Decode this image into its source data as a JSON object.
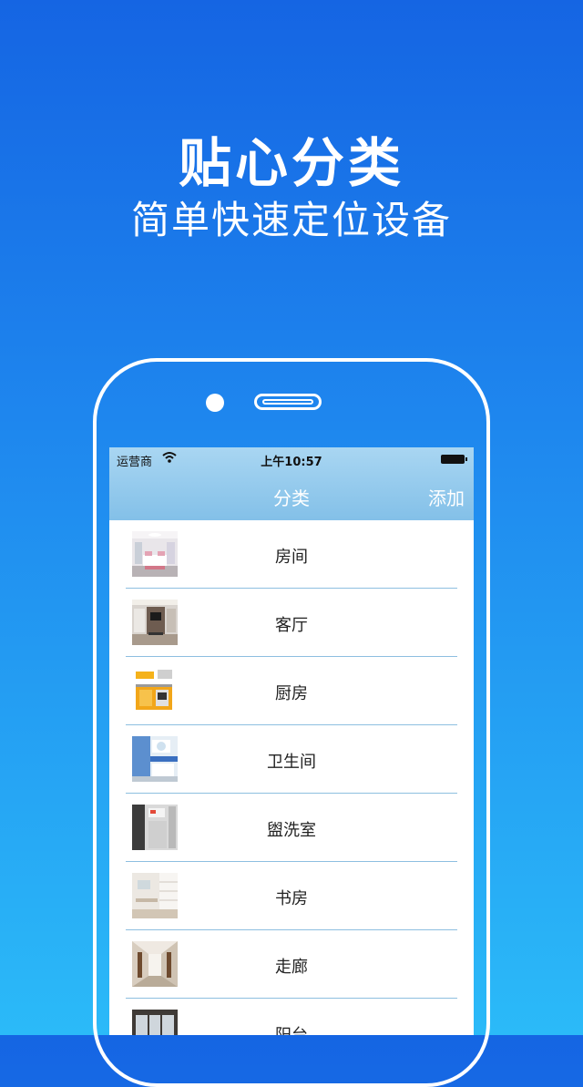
{
  "promo": {
    "headline": "贴心分类",
    "subline": "简单快速定位设备"
  },
  "status_bar": {
    "carrier": "运营商",
    "time": "上午10:57"
  },
  "nav": {
    "title": "分类",
    "add_label": "添加"
  },
  "categories": [
    {
      "label": "房间",
      "icon": "bedroom-photo"
    },
    {
      "label": "客厅",
      "icon": "living-room-photo"
    },
    {
      "label": "厨房",
      "icon": "kitchen-photo"
    },
    {
      "label": "卫生间",
      "icon": "bathroom-photo"
    },
    {
      "label": "盥洗室",
      "icon": "washroom-photo"
    },
    {
      "label": "书房",
      "icon": "study-photo"
    },
    {
      "label": "走廊",
      "icon": "corridor-photo"
    },
    {
      "label": "阳台",
      "icon": "balcony-photo"
    }
  ],
  "colors": {
    "background_top": "#1565e3",
    "background_bottom": "#2bbaf8",
    "navbar": "#9ccff0",
    "separator": "#8dbfe0"
  }
}
